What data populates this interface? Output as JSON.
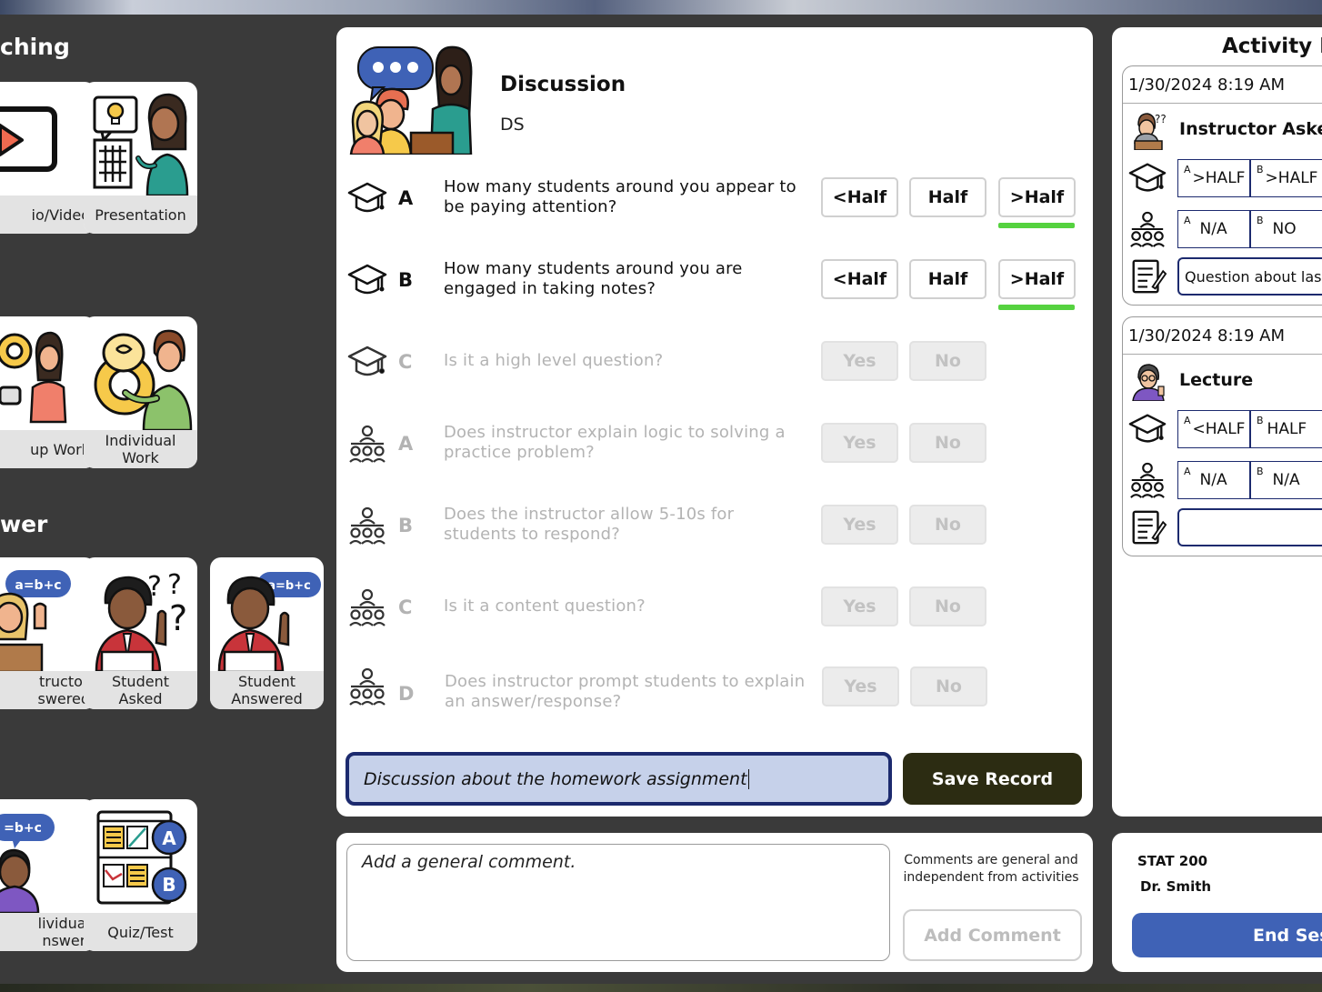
{
  "palette": {
    "sections": {
      "teaching": "ching",
      "answer": "wer"
    },
    "tiles": {
      "audio_video": "io/Video",
      "presentation": "Presentation",
      "group_work": "up Work",
      "individual_work": "Individual\nWork",
      "instructor_answered": "tructor\nswered",
      "student_asked": "Student\nAsked",
      "student_answered": "Student\nAnswered",
      "individual_answer": "lividual\nnswer",
      "quiz_test": "Quiz/Test"
    },
    "icon_text": {
      "formula": "a=b+c",
      "formula_clipped": "=b+c",
      "quiz_a": "A",
      "quiz_b": "B",
      "question_marks": "??"
    }
  },
  "activity": {
    "title": "Discussion",
    "code": "DS",
    "questions": [
      {
        "letter": "A",
        "text": "How many students around you appear to be paying attention?",
        "options": [
          "<Half",
          "Half",
          ">Half"
        ],
        "selected": ">Half",
        "icon": "graduation-cap-icon"
      },
      {
        "letter": "B",
        "text": "How many students around you are engaged in taking notes?",
        "options": [
          "<Half",
          "Half",
          ">Half"
        ],
        "selected": ">Half",
        "icon": "graduation-cap-icon"
      },
      {
        "letter": "C",
        "text": "Is it a high level question?",
        "options": [
          "Yes",
          "No"
        ],
        "icon": "graduation-cap-icon"
      },
      {
        "letter": "A",
        "text": "Does instructor explain logic to solving a practice problem?",
        "options": [
          "Yes",
          "No"
        ],
        "icon": "classroom-icon"
      },
      {
        "letter": "B",
        "text": "Does the instructor allow 5-10s for students to respond?",
        "options": [
          "Yes",
          "No"
        ],
        "icon": "classroom-icon"
      },
      {
        "letter": "C",
        "text": "Is it a content question?",
        "options": [
          "Yes",
          "No"
        ],
        "icon": "classroom-icon"
      },
      {
        "letter": "D",
        "text": "Does instructor prompt students to explain an answer/response?",
        "options": [
          "Yes",
          "No"
        ],
        "icon": "classroom-icon"
      }
    ],
    "note_value": "Discussion about the homework assignment",
    "save_label": "Save Record"
  },
  "comment": {
    "placeholder": "Add a general comment.",
    "note": "Comments are general and independent from activities",
    "button": "Add Comment"
  },
  "log": {
    "title": "Activity L",
    "entries": [
      {
        "timestamp": "1/30/2024 8:19 AM",
        "kind": "Instructor Aske",
        "student_a": ">HALF",
        "student_b": ">HALF",
        "instructor_a": "N/A",
        "instructor_b": "NO",
        "note": "Question about las"
      },
      {
        "timestamp": "1/30/2024 8:19 AM",
        "kind": "Lecture",
        "student_a": "<HALF",
        "student_b": "HALF",
        "instructor_a": "N/A",
        "instructor_b": "N/A",
        "note": ""
      }
    ],
    "sup_a": "A",
    "sup_b": "B"
  },
  "course": {
    "code": "STAT 200",
    "instructor": "Dr. Smith",
    "end_label": "End Ses"
  },
  "colors": {
    "background": "#3a3a3a",
    "selected": "#55d23f",
    "save": "#2c2c12",
    "end": "#3f62b6",
    "input_border": "#1c2a6e"
  }
}
